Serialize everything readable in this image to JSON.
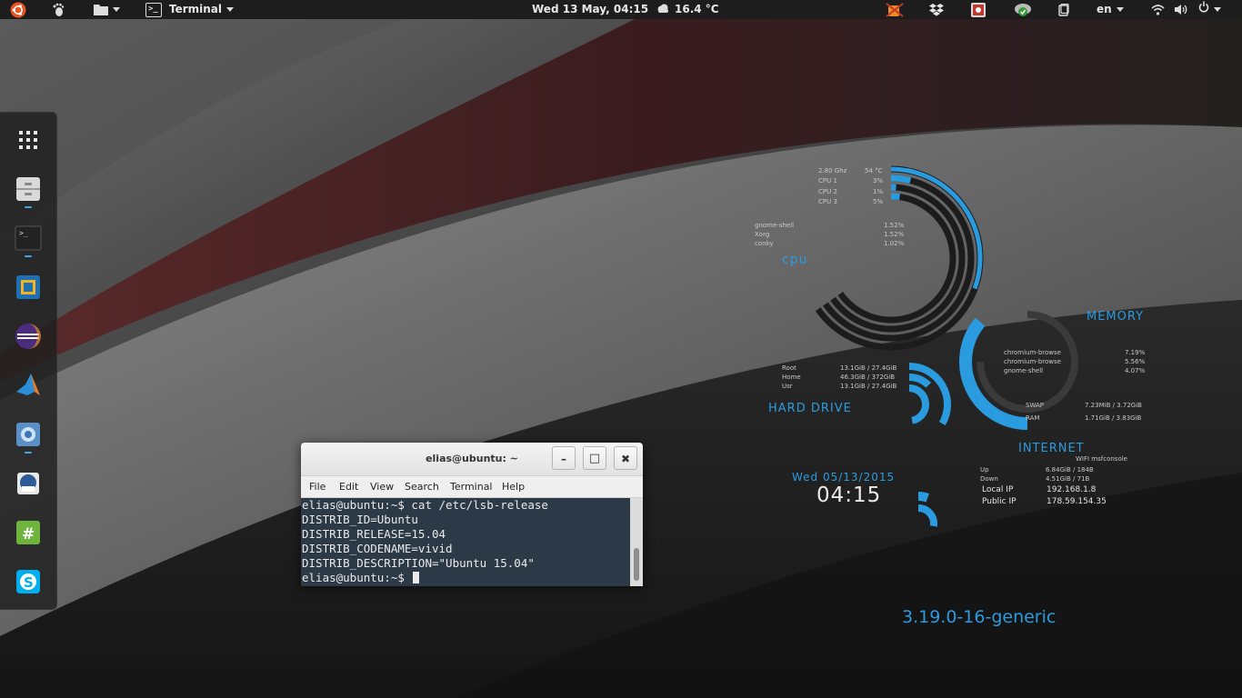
{
  "top_panel": {
    "app_menu_label": "Terminal",
    "clock": "Wed 13 May, 04:15",
    "weather": "16.4 °C",
    "language": "en",
    "icons": [
      "ubuntu-logo-icon",
      "gnome-foot-icon",
      "folder-icon",
      "terminal-icon",
      "cloud-icon",
      "caffeine-icon",
      "dropbox-icon",
      "screenshot-icon",
      "update-icon",
      "clipboard-icon",
      "wifi-icon",
      "volume-icon",
      "power-icon"
    ],
    "caffeine_label": "C+off"
  },
  "dock": {
    "items": [
      {
        "name": "show-applications",
        "running": false
      },
      {
        "name": "files",
        "running": true
      },
      {
        "name": "terminal",
        "running": true
      },
      {
        "name": "virtualbox",
        "running": false
      },
      {
        "name": "eclipse",
        "running": false
      },
      {
        "name": "matlab",
        "running": false
      },
      {
        "name": "chromium",
        "running": true
      },
      {
        "name": "thunderbird",
        "running": false
      },
      {
        "name": "hashtag-app",
        "running": false
      },
      {
        "name": "skype",
        "running": false
      }
    ]
  },
  "conky": {
    "cpu": {
      "title": "cpu",
      "freq": "2.80 Ghz",
      "temp": "54 °C",
      "cores": [
        {
          "label": "CPU 1",
          "value": "3%"
        },
        {
          "label": "CPU 2",
          "value": "1%"
        },
        {
          "label": "CPU 3",
          "value": "5%"
        }
      ],
      "processes": [
        {
          "name": "gnome-shell",
          "value": "1.52%"
        },
        {
          "name": "Xorg",
          "value": "1.52%"
        },
        {
          "name": "conky",
          "value": "1.02%"
        }
      ]
    },
    "memory": {
      "title": "MEMORY",
      "processes": [
        {
          "name": "chromium-browse",
          "value": "7.19%"
        },
        {
          "name": "chromium-browse",
          "value": "5.56%"
        },
        {
          "name": "gnome-shell",
          "value": "4.07%"
        }
      ],
      "swap_label": "SWAP",
      "swap_value": "7.23MiB / 3.72GiB",
      "ram_label": "RAM",
      "ram_value": "1.71GiB / 3.83GiB"
    },
    "hard_drive": {
      "title": "HARD DRIVE",
      "rows": [
        {
          "label": "Root",
          "value": "13.1GiB / 27.4GiB"
        },
        {
          "label": "Home",
          "value": "46.3GiB / 372GiB"
        },
        {
          "label": "Usr",
          "value": "13.1GiB / 27.4GiB"
        }
      ]
    },
    "internet": {
      "title": "INTERNET",
      "connection": "WIFI msfconsole",
      "up_label": "Up",
      "up_value": "6.84GiB / 184B",
      "down_label": "Down",
      "down_value": "4.51GiB / 71B",
      "local_label": "Local IP",
      "local_value": "192.168.1.8",
      "public_label": "Public IP",
      "public_value": "178.59.154.35"
    },
    "date": "Wed 05/13/2015",
    "time": "04:15",
    "kernel": "3.19.0-16-generic"
  },
  "terminal": {
    "title": "elias@ubuntu: ~",
    "buttons": {
      "minimize": "–",
      "maximize": "□",
      "close": "✖"
    },
    "menu": [
      "File",
      "Edit",
      "View",
      "Search",
      "Terminal",
      "Help"
    ],
    "lines": [
      "elias@ubuntu:~$ cat /etc/lsb-release",
      "DISTRIB_ID=Ubuntu",
      "DISTRIB_RELEASE=15.04",
      "DISTRIB_CODENAME=vivid",
      "DISTRIB_DESCRIPTION=\"Ubuntu 15.04\""
    ],
    "prompt": "elias@ubuntu:~$ "
  },
  "colors": {
    "accent": "#2b9be0",
    "panel": "#1d1d1d",
    "terminal_bg": "#2c3a47"
  }
}
